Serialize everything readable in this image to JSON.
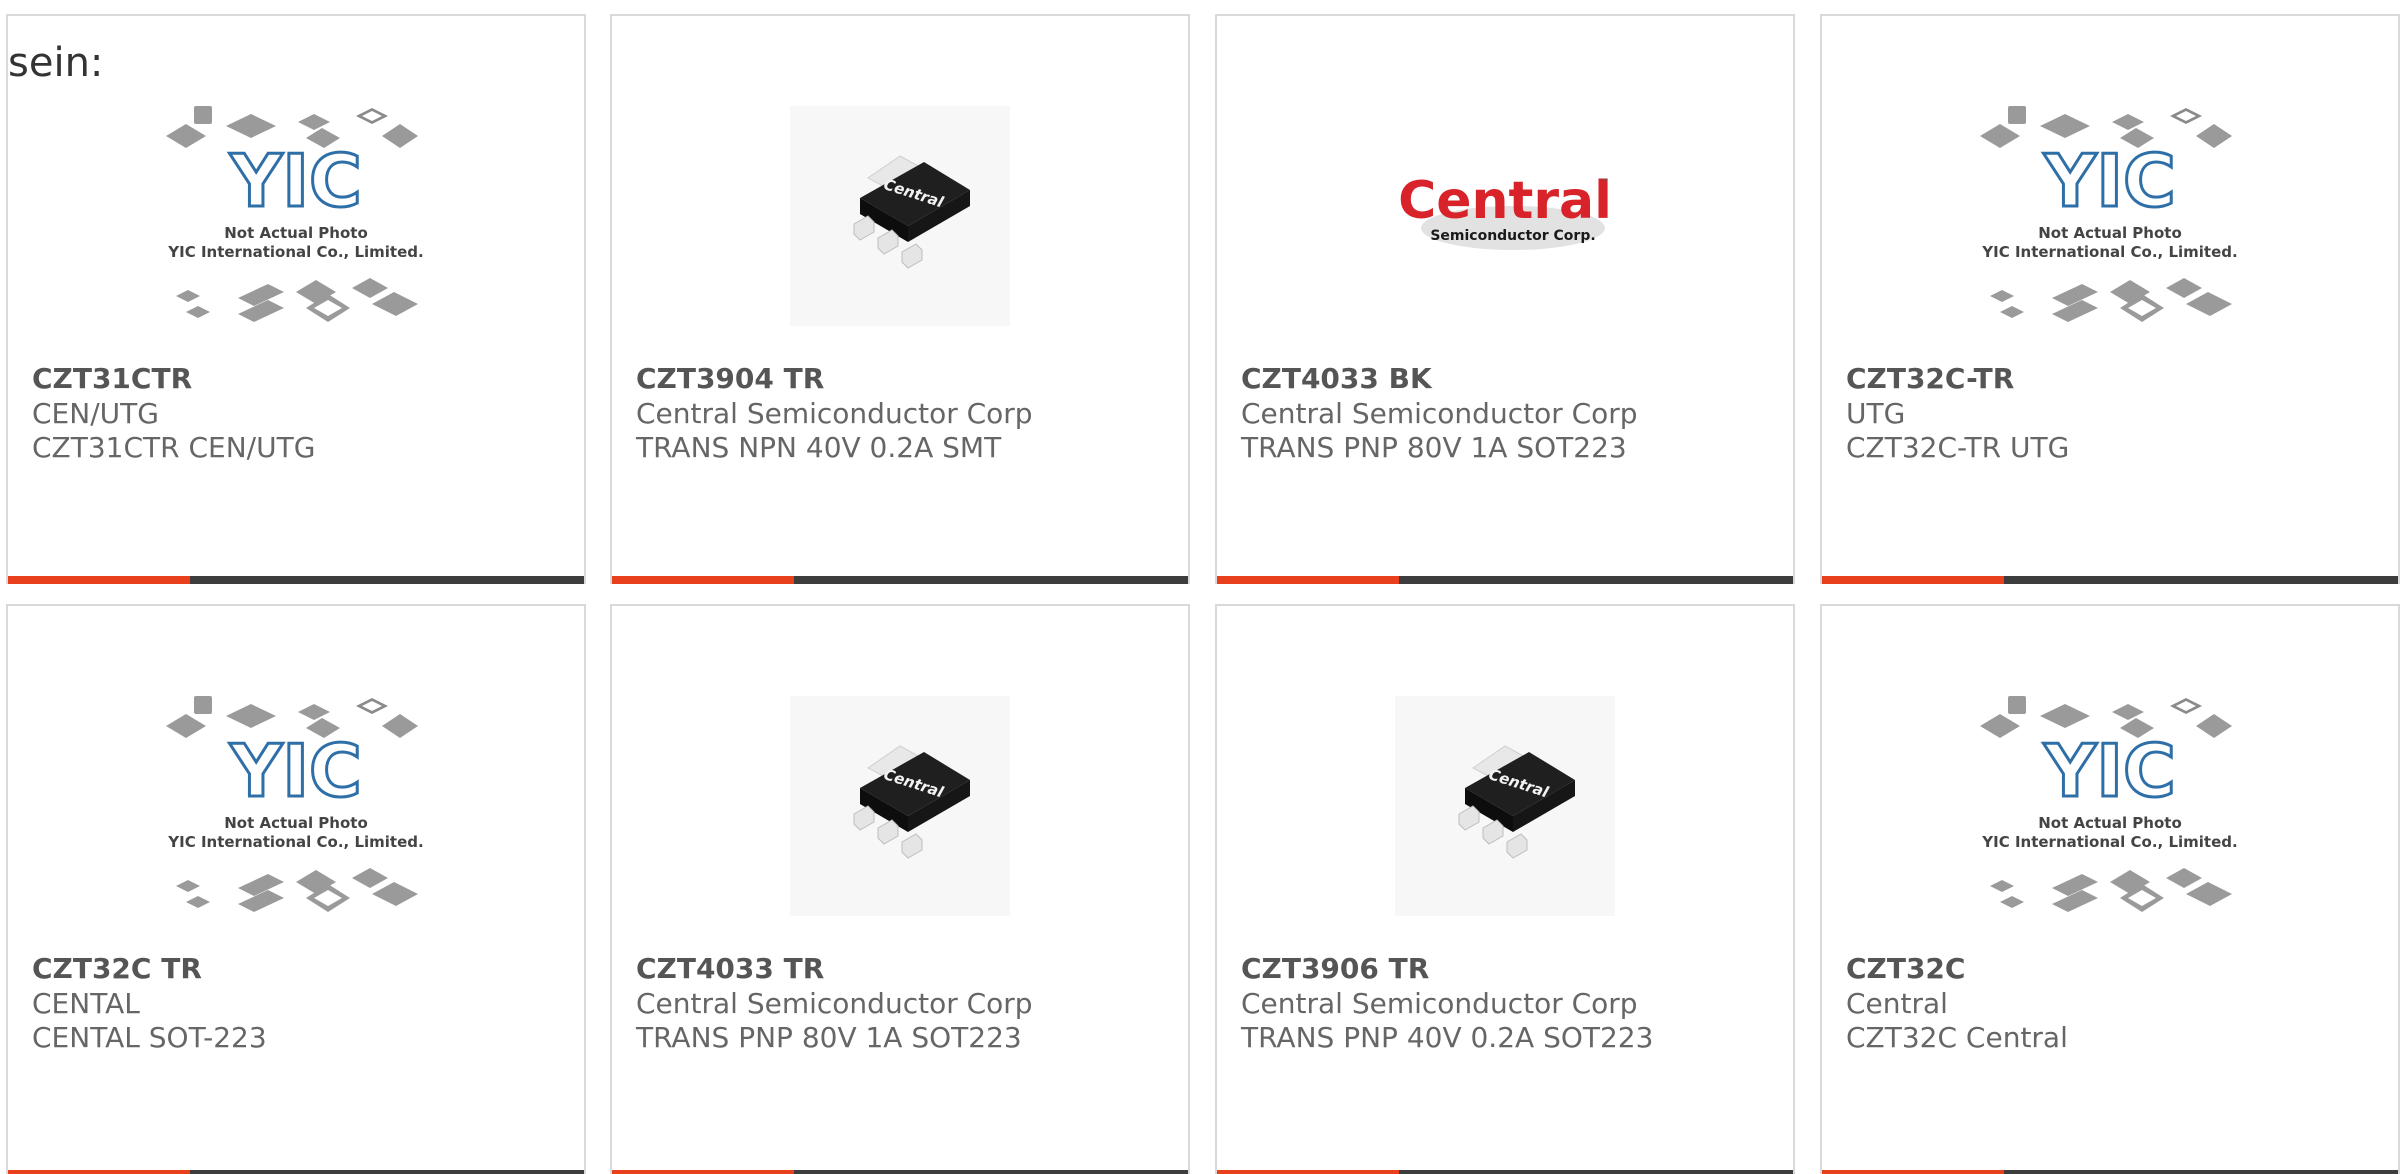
{
  "lead_text": "sein:",
  "accent_color": "#e8401c",
  "bar_color": "#3d3d3d",
  "placeholder": {
    "line1": "Not Actual Photo",
    "line2": "YIC International Co., Limited.",
    "logo": "YIC"
  },
  "central_logo": {
    "main": "Central",
    "sub": "Semiconductor Corp.",
    "tm": "™"
  },
  "chip_label": "Central",
  "cards": [
    {
      "part": "CZT31CTR",
      "maker": "CEN/UTG",
      "desc": "CZT31CTR CEN/UTG",
      "image": "yic-placeholder"
    },
    {
      "part": "CZT3904 TR",
      "maker": "Central Semiconductor Corp",
      "desc": "TRANS NPN 40V 0.2A SMT",
      "image": "sot223-chip"
    },
    {
      "part": "CZT4033 BK",
      "maker": "Central Semiconductor Corp",
      "desc": "TRANS PNP 80V 1A SOT223",
      "image": "central-logo"
    },
    {
      "part": "CZT32C-TR",
      "maker": "UTG",
      "desc": "CZT32C-TR UTG",
      "image": "yic-placeholder"
    },
    {
      "part": "CZT32C TR",
      "maker": "CENTAL",
      "desc": "CENTAL SOT-223",
      "image": "yic-placeholder"
    },
    {
      "part": "CZT4033 TR",
      "maker": "Central Semiconductor Corp",
      "desc": "TRANS PNP 80V 1A SOT223",
      "image": "sot223-chip"
    },
    {
      "part": "CZT3906 TR",
      "maker": "Central Semiconductor Corp",
      "desc": "TRANS PNP 40V 0.2A SOT223",
      "image": "sot223-chip"
    },
    {
      "part": "CZT32C",
      "maker": "Central",
      "desc": "CZT32C Central",
      "image": "yic-placeholder"
    }
  ]
}
